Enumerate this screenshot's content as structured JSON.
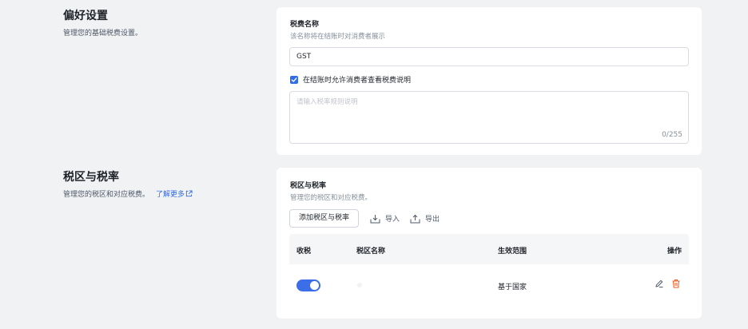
{
  "preferences": {
    "title": "偏好设置",
    "description": "管理您的基础税费设置。",
    "tax_name_label": "税费名称",
    "tax_name_help": "该名称将在结账时对消费者展示",
    "tax_name_value": "GST",
    "allow_view_label": "在结账时允许消费者查看税费说明",
    "allow_view_checked": true,
    "description_placeholder": "请输入税率规则说明",
    "description_counter": "0/255"
  },
  "tax_zones": {
    "title": "税区与税率",
    "description": "管理您的税区和对应税费。",
    "learn_more": "了解更多",
    "card_title": "税区与税率",
    "card_description": "管理您的税区和对应税费。",
    "add_button": "添加税区与税率",
    "import_label": "导入",
    "export_label": "导出",
    "columns": {
      "collect": "收税",
      "zone_name": "税区名称",
      "scope": "生效范围",
      "actions": "操作"
    },
    "rows": [
      {
        "collect_enabled": true,
        "zone_name": "",
        "scope": "基于国家"
      }
    ]
  },
  "colors": {
    "accent": "#2f6bea",
    "toggle": "#3b6ee8",
    "delete": "#e8591a",
    "background": "#f1f2f4"
  }
}
